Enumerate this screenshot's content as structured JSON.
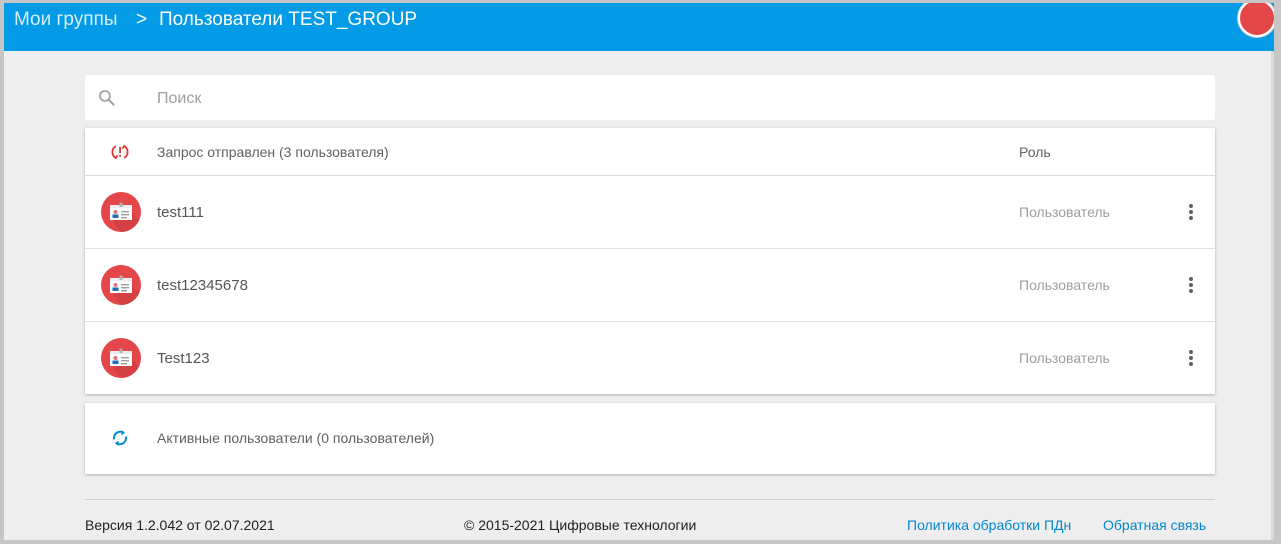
{
  "header": {
    "breadcrumb_parent": "Мои группы",
    "breadcrumb_separator": ">",
    "breadcrumb_current": "Пользователи TEST_GROUP"
  },
  "search": {
    "placeholder": "Поиск"
  },
  "pending": {
    "title": "Запрос отправлен (3 пользователя)",
    "role_header": "Роль",
    "users": [
      {
        "name": "test111",
        "role": "Пользователь"
      },
      {
        "name": "test12345678",
        "role": "Пользователь"
      },
      {
        "name": "Test123",
        "role": "Пользователь"
      }
    ]
  },
  "active": {
    "title": "Активные пользователи (0 пользователей)"
  },
  "footer": {
    "version": "Версия 1.2.042 от 02.07.2021",
    "copyright": "© 2015-2021 Цифровые технологии",
    "policy_link": "Политика обработки ПДн",
    "feedback_link": "Обратная связь"
  },
  "colors": {
    "appbar": "#039be5",
    "avatar": "#e34749",
    "pending_icon": "#e53935",
    "active_icon": "#0288d1",
    "link": "#0288d1"
  },
  "icons": {
    "search": "search-icon",
    "pending": "sync-problem-icon",
    "active": "sync-icon",
    "user": "contact-card-avatar-icon",
    "menu": "more-vert-icon"
  }
}
